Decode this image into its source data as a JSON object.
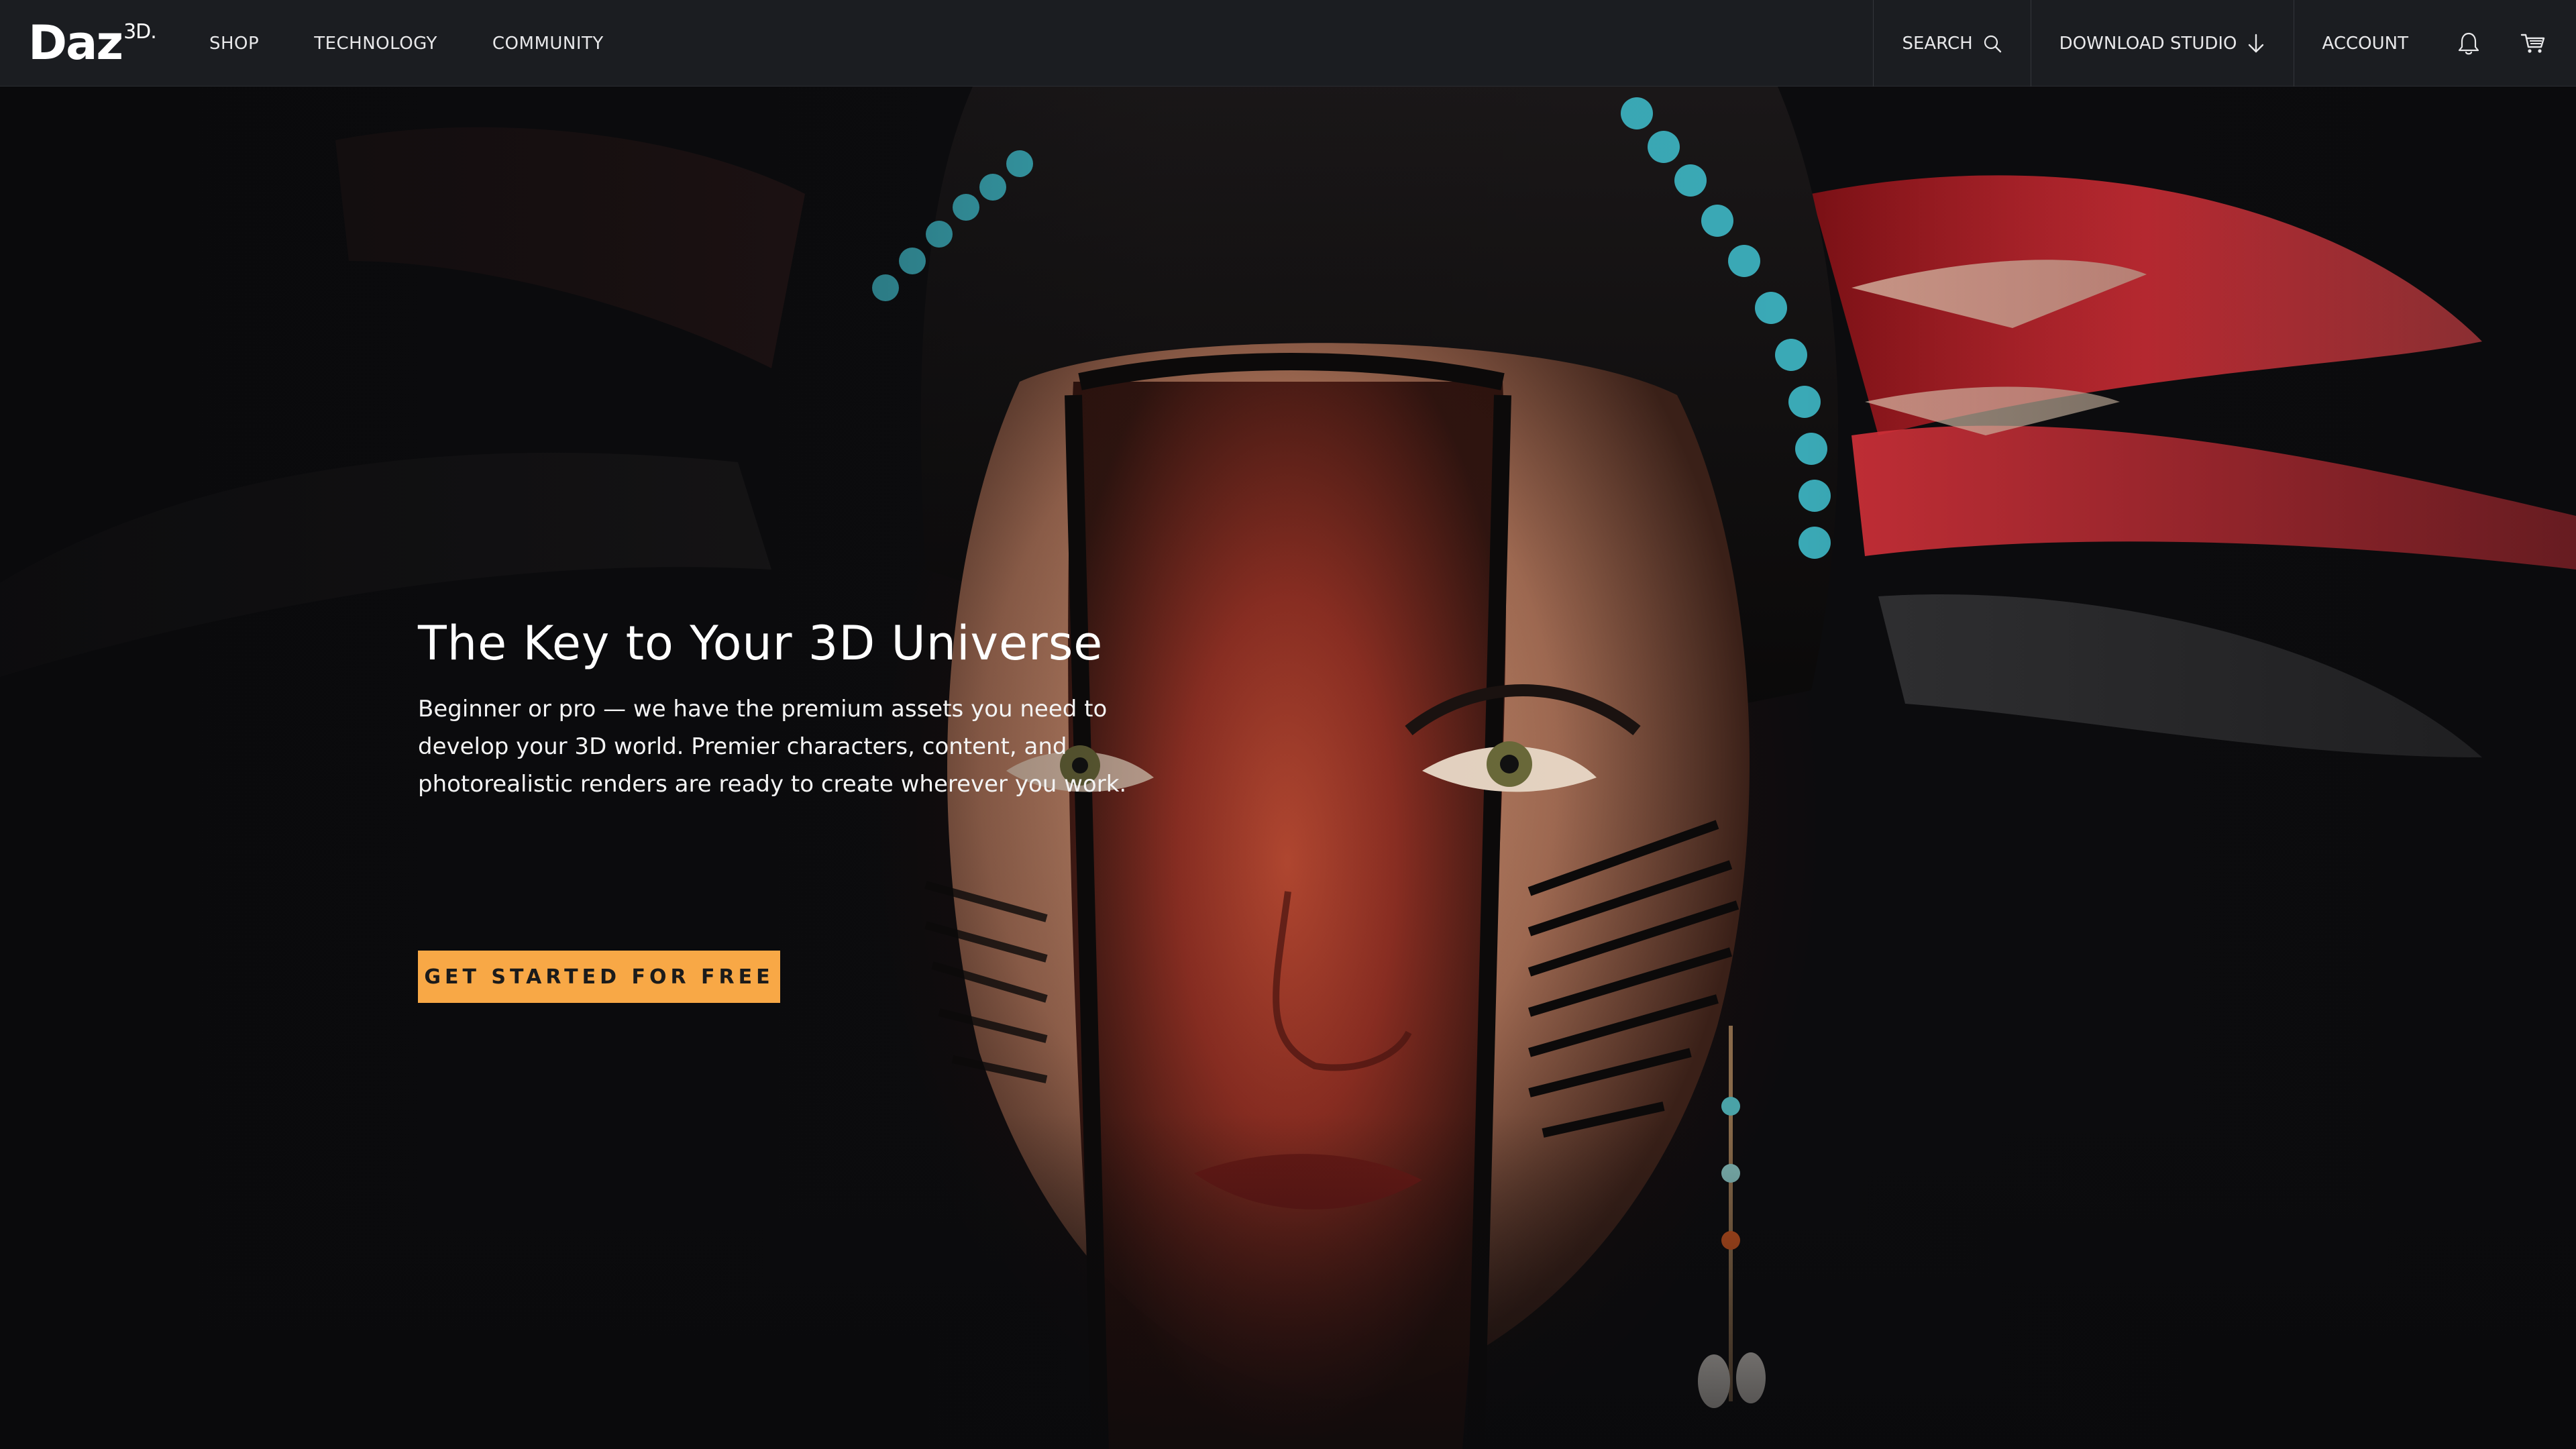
{
  "header": {
    "logo": {
      "main": "Daz",
      "sup": "3D."
    },
    "nav_left": [
      "SHOP",
      "TECHNOLOGY",
      "COMMUNITY"
    ],
    "search_label": "SEARCH",
    "download_label": "DOWNLOAD STUDIO",
    "account_label": "ACCOUNT",
    "icons": {
      "search": "search-icon",
      "download": "arrow-down-icon",
      "notifications": "bell-icon",
      "cart": "cart-icon"
    }
  },
  "hero": {
    "title": "The Key to Your 3D Universe",
    "text": "Beginner or pro — we have the premium assets you need to develop your 3D world. Premier characters, content, and photorealistic renders are ready to create wherever you work.",
    "cta_label": "GET STARTED FOR FREE"
  },
  "colors": {
    "header_bg": "#1b1d21",
    "accent": "#f8a846"
  }
}
